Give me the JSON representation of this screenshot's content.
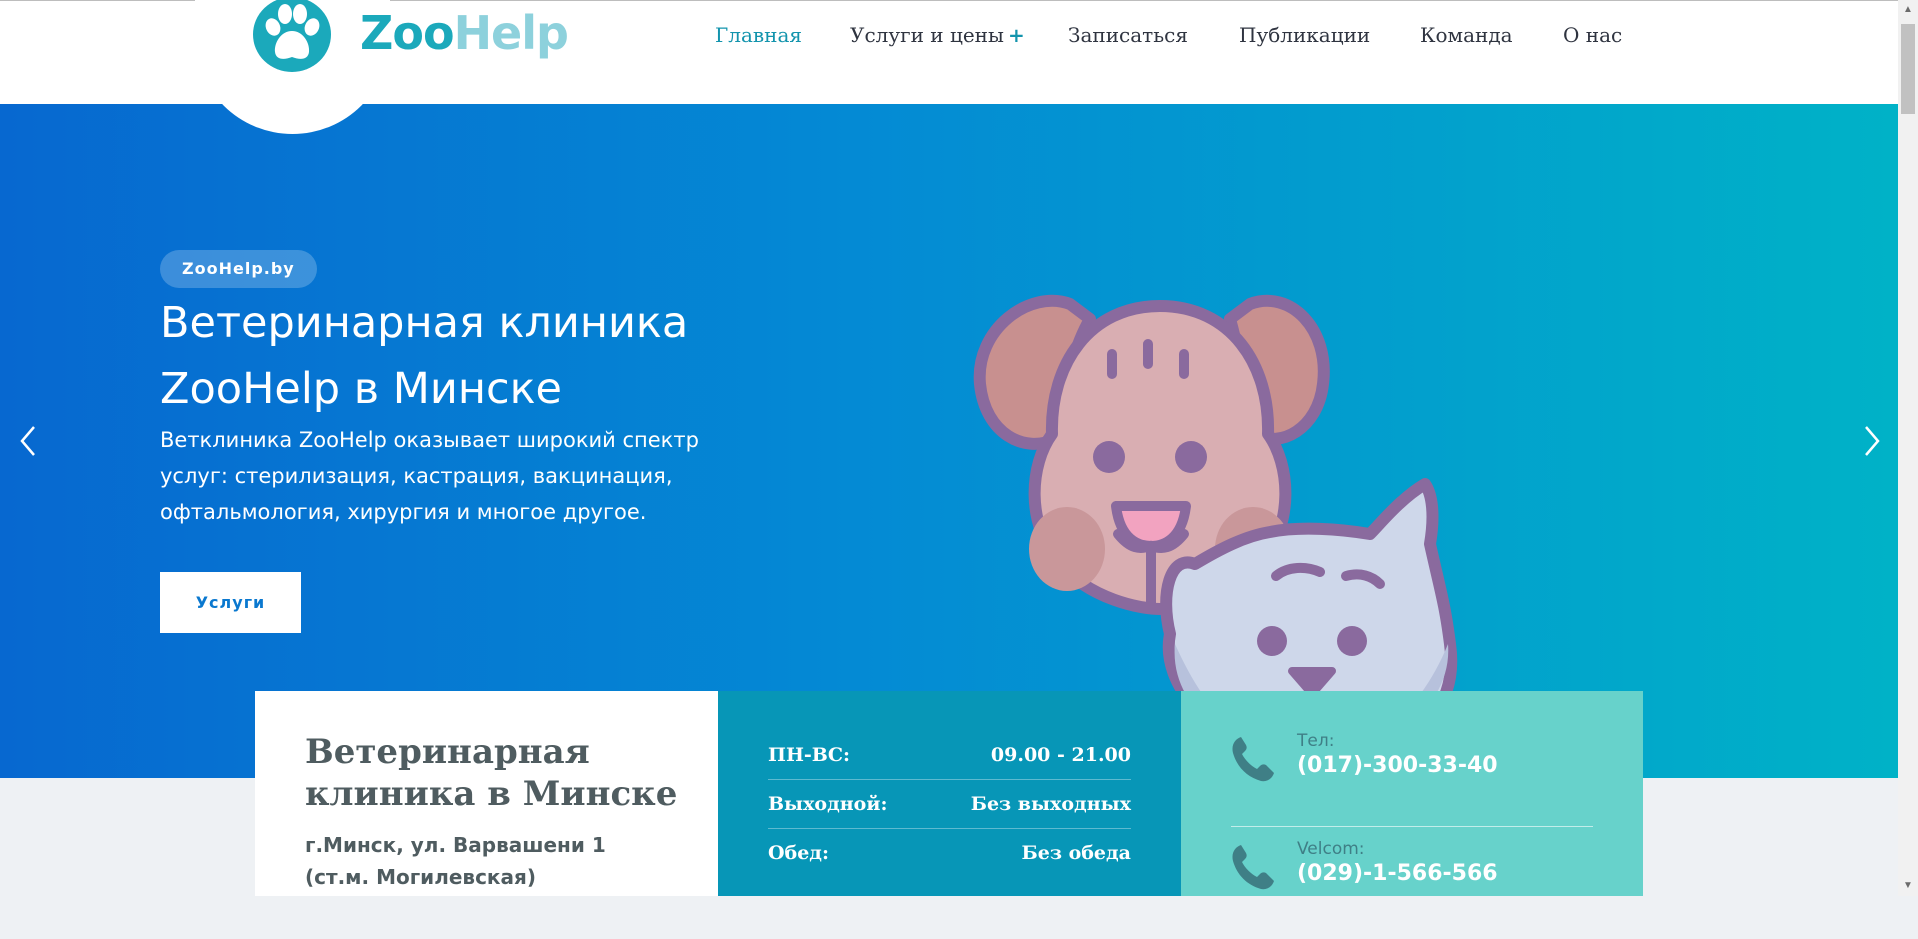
{
  "header": {
    "brand_part1": "Zoo",
    "brand_part2": "Help",
    "logo_icon": "paw-icon",
    "nav": [
      {
        "label": "Главная",
        "active": true
      },
      {
        "label": "Услуги и цены",
        "has_submenu": true,
        "submenu_marker": "+"
      },
      {
        "label": "Записаться"
      },
      {
        "label": "Публикации"
      },
      {
        "label": "Команда"
      },
      {
        "label": "О нас"
      }
    ]
  },
  "hero": {
    "badge": "ZooHelp.by",
    "title": "Ветеринарная клиника ZooHelp в Минске",
    "text": "Ветклиника ZooHelp оказывает широкий спектр услуг: стерилизация, кастрация, вакцинация, офтальмология, хирургия и многое другое.",
    "button": "Услуги",
    "illustration": "dog-and-cat-illustration",
    "prev_icon": "chevron-left-icon",
    "next_icon": "chevron-right-icon"
  },
  "info": {
    "title": "Ветеринарная клиника в Минске",
    "address": "г.Минск, ул. Варвашени 1 (ст.м. Могилевская)",
    "hours": [
      {
        "label": "ПН-ВС:",
        "value": "09.00 - 21.00"
      },
      {
        "label": "Выходной:",
        "value": "Без выходных"
      },
      {
        "label": "Обед:",
        "value": "Без обеда"
      }
    ],
    "phones": [
      {
        "label": "Тел:",
        "number": "(017)-300-33-40"
      },
      {
        "label": "Velcom:",
        "number": "(029)-1-566-566"
      }
    ]
  },
  "colors": {
    "brand": "#1ba9bb",
    "nav_active": "#1394ad",
    "hero_gradient_start": "#0768d0",
    "hero_gradient_end": "#00b2c7",
    "hours_panel": "#0796b7",
    "phones_panel": "#67d2cb"
  }
}
